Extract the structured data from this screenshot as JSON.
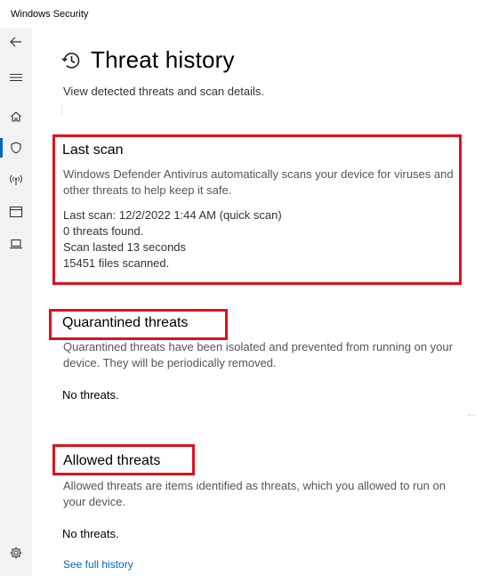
{
  "app": {
    "title": "Windows Security"
  },
  "page": {
    "title": "Threat history",
    "subtitle": "View detected threats and scan details."
  },
  "last_scan": {
    "title": "Last scan",
    "description": "Windows Defender Antivirus automatically scans your device for viruses and other threats to help keep it safe.",
    "details": [
      "Last scan: 12/2/2022 1:44 AM (quick scan)",
      "0 threats found.",
      "Scan lasted 13 seconds",
      "15451 files scanned."
    ]
  },
  "quarantined": {
    "title": "Quarantined threats",
    "description": "Quarantined threats have been isolated and prevented from running on your device.  They will be periodically removed.",
    "status": "No threats."
  },
  "allowed": {
    "title": "Allowed threats",
    "description": "Allowed threats are items identified as threats, which you allowed to run on your device.",
    "status": "No threats."
  },
  "link": {
    "label": "See full history"
  },
  "sidebar": {
    "items": [
      {
        "icon": "back-arrow-icon"
      },
      {
        "icon": "hamburger-menu-icon"
      },
      {
        "icon": "home-icon"
      },
      {
        "icon": "shield-icon",
        "active": true
      },
      {
        "icon": "wireless-icon"
      },
      {
        "icon": "app-browser-icon"
      },
      {
        "icon": "laptop-icon"
      },
      {
        "icon": "gear-icon"
      }
    ]
  },
  "colors": {
    "accent": "#0067c0",
    "highlight": "#e0101d",
    "sidebar_bg": "#f2f2f2"
  }
}
